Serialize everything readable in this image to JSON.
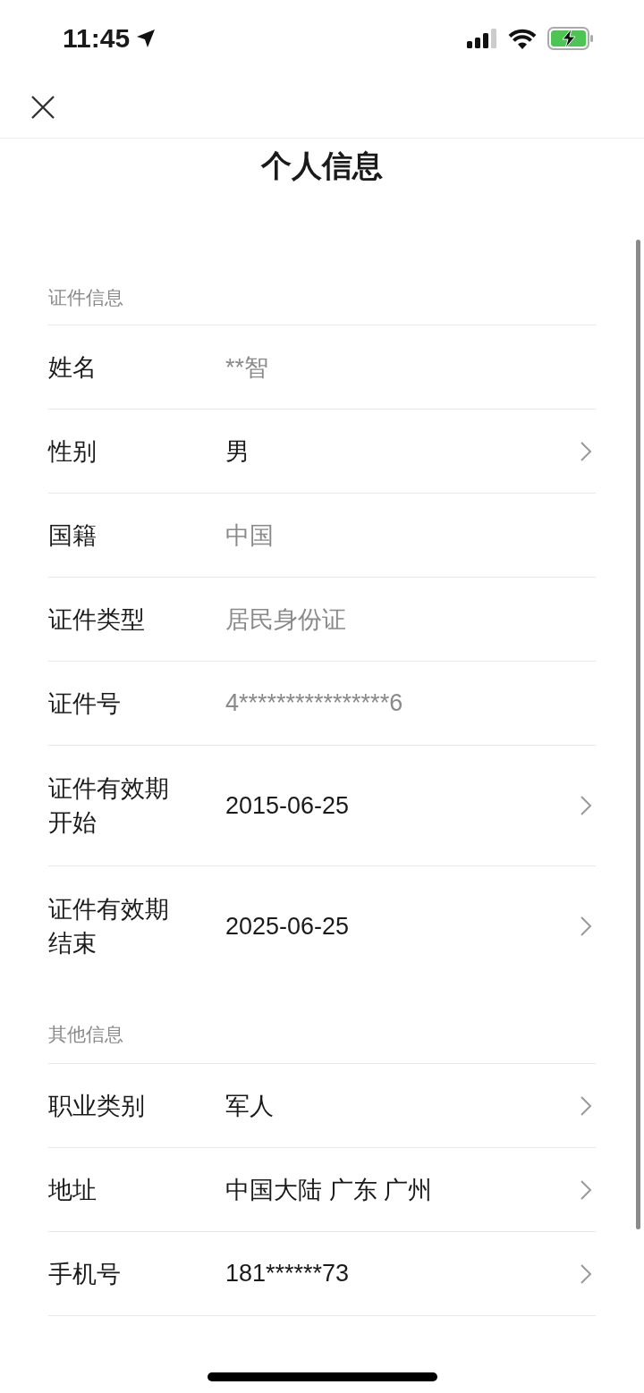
{
  "status_bar": {
    "time": "11:45"
  },
  "title": "个人信息",
  "sections": [
    {
      "header": "证件信息",
      "rows": [
        {
          "label": "姓名",
          "value": "**智",
          "editable": false
        },
        {
          "label": "性别",
          "value": "男",
          "editable": true
        },
        {
          "label": "国籍",
          "value": "中国",
          "editable": false
        },
        {
          "label": "证件类型",
          "value": "居民身份证",
          "editable": false
        },
        {
          "label": "证件号",
          "value": "4****************6",
          "editable": false
        },
        {
          "label": "证件有效期开始",
          "value": "2015-06-25",
          "editable": true
        },
        {
          "label": "证件有效期结束",
          "value": "2025-06-25",
          "editable": true
        }
      ]
    },
    {
      "header": "其他信息",
      "rows": [
        {
          "label": "职业类别",
          "value": "军人",
          "editable": true
        },
        {
          "label": "地址",
          "value": "中国大陆 广东 广州",
          "editable": true
        },
        {
          "label": "手机号",
          "value": "181******73",
          "editable": true
        }
      ]
    }
  ]
}
